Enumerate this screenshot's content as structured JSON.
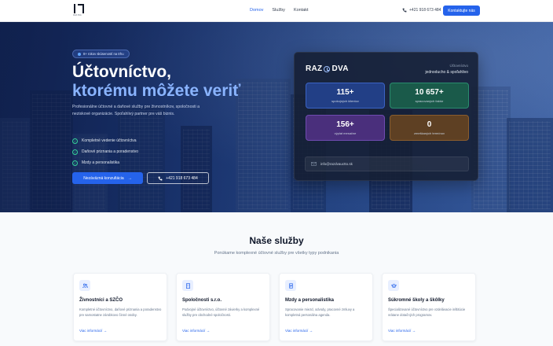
{
  "nav": {
    "logo_sub": "RAZ DVA",
    "links": [
      {
        "label": "Domov",
        "active": true
      },
      {
        "label": "Služby",
        "active": false
      },
      {
        "label": "Kontakt",
        "active": false
      }
    ],
    "phone": "+421 918 673 484",
    "cta": "Kontaktujte nás"
  },
  "hero": {
    "badge": "8+ rokov skúseností na trhu",
    "title_line1": "Účtovníctvo,",
    "title_line2": "ktorému môžete veriť",
    "lead": "Profesionálne účtovné a daňové služby pre živnostníkov, spoločnosti a neziskové organizácie. Spoľahlivý partner pre váš biznis.",
    "checks": [
      "Kompletné vedenie účtovníctva",
      "Daňové priznania a poradenstvo",
      "Mzdy a personalistika"
    ],
    "primary_button": "Nezáväzná konzultácia",
    "phone_button": "+421 918 673 484"
  },
  "stats_card": {
    "logo_left": "RAZ",
    "logo_right": "DVA",
    "sub1": "Účtovníctvo",
    "sub2": "jednoducho & spoľahlivo",
    "stats": [
      {
        "value": "115+",
        "label": "spokojných klientov",
        "color": "#223f86"
      },
      {
        "value": "10 657+",
        "label": "spracovaných faktúr",
        "color": "#1a5a4a"
      },
      {
        "value": "156+",
        "label": "výplat mesačne",
        "color": "#4a2f7c"
      },
      {
        "value": "0",
        "label": "zmeškaných termínov",
        "color": "#5e4023"
      }
    ],
    "email": "info@razdvauctto.sk"
  },
  "services": {
    "title": "Naše služby",
    "subtitle": "Ponúkame komplexné účtovné služby pre všetky typy podnikania",
    "items": [
      {
        "icon": "users-icon",
        "title": "Živnostníci a SZČO",
        "desc": "Kompletné účtovníctvo, daňové priznania a poradenstvo pre samostatne zárobkovo činné osoby.",
        "link": "Viac informácií"
      },
      {
        "icon": "building-icon",
        "title": "Spoločnosti s.r.o.",
        "desc": "Podvojné účtovníctvo, účtovné závierky a komplexné služby pre obchodné spoločnosti.",
        "link": "Viac informácií"
      },
      {
        "icon": "document-icon",
        "title": "Mzdy a personalistika",
        "desc": "Spracovanie miezd, odvody, pracovné zmluvy a kompletná personálna agenda.",
        "link": "Viac informácií"
      },
      {
        "icon": "graduation-cap-icon",
        "title": "Súkromné školy a škôlky",
        "desc": "Špecializované účtovníctvo pre vzdelávacie inštitúcie vrátane dotačných programov.",
        "link": "Viac informácií"
      }
    ]
  }
}
